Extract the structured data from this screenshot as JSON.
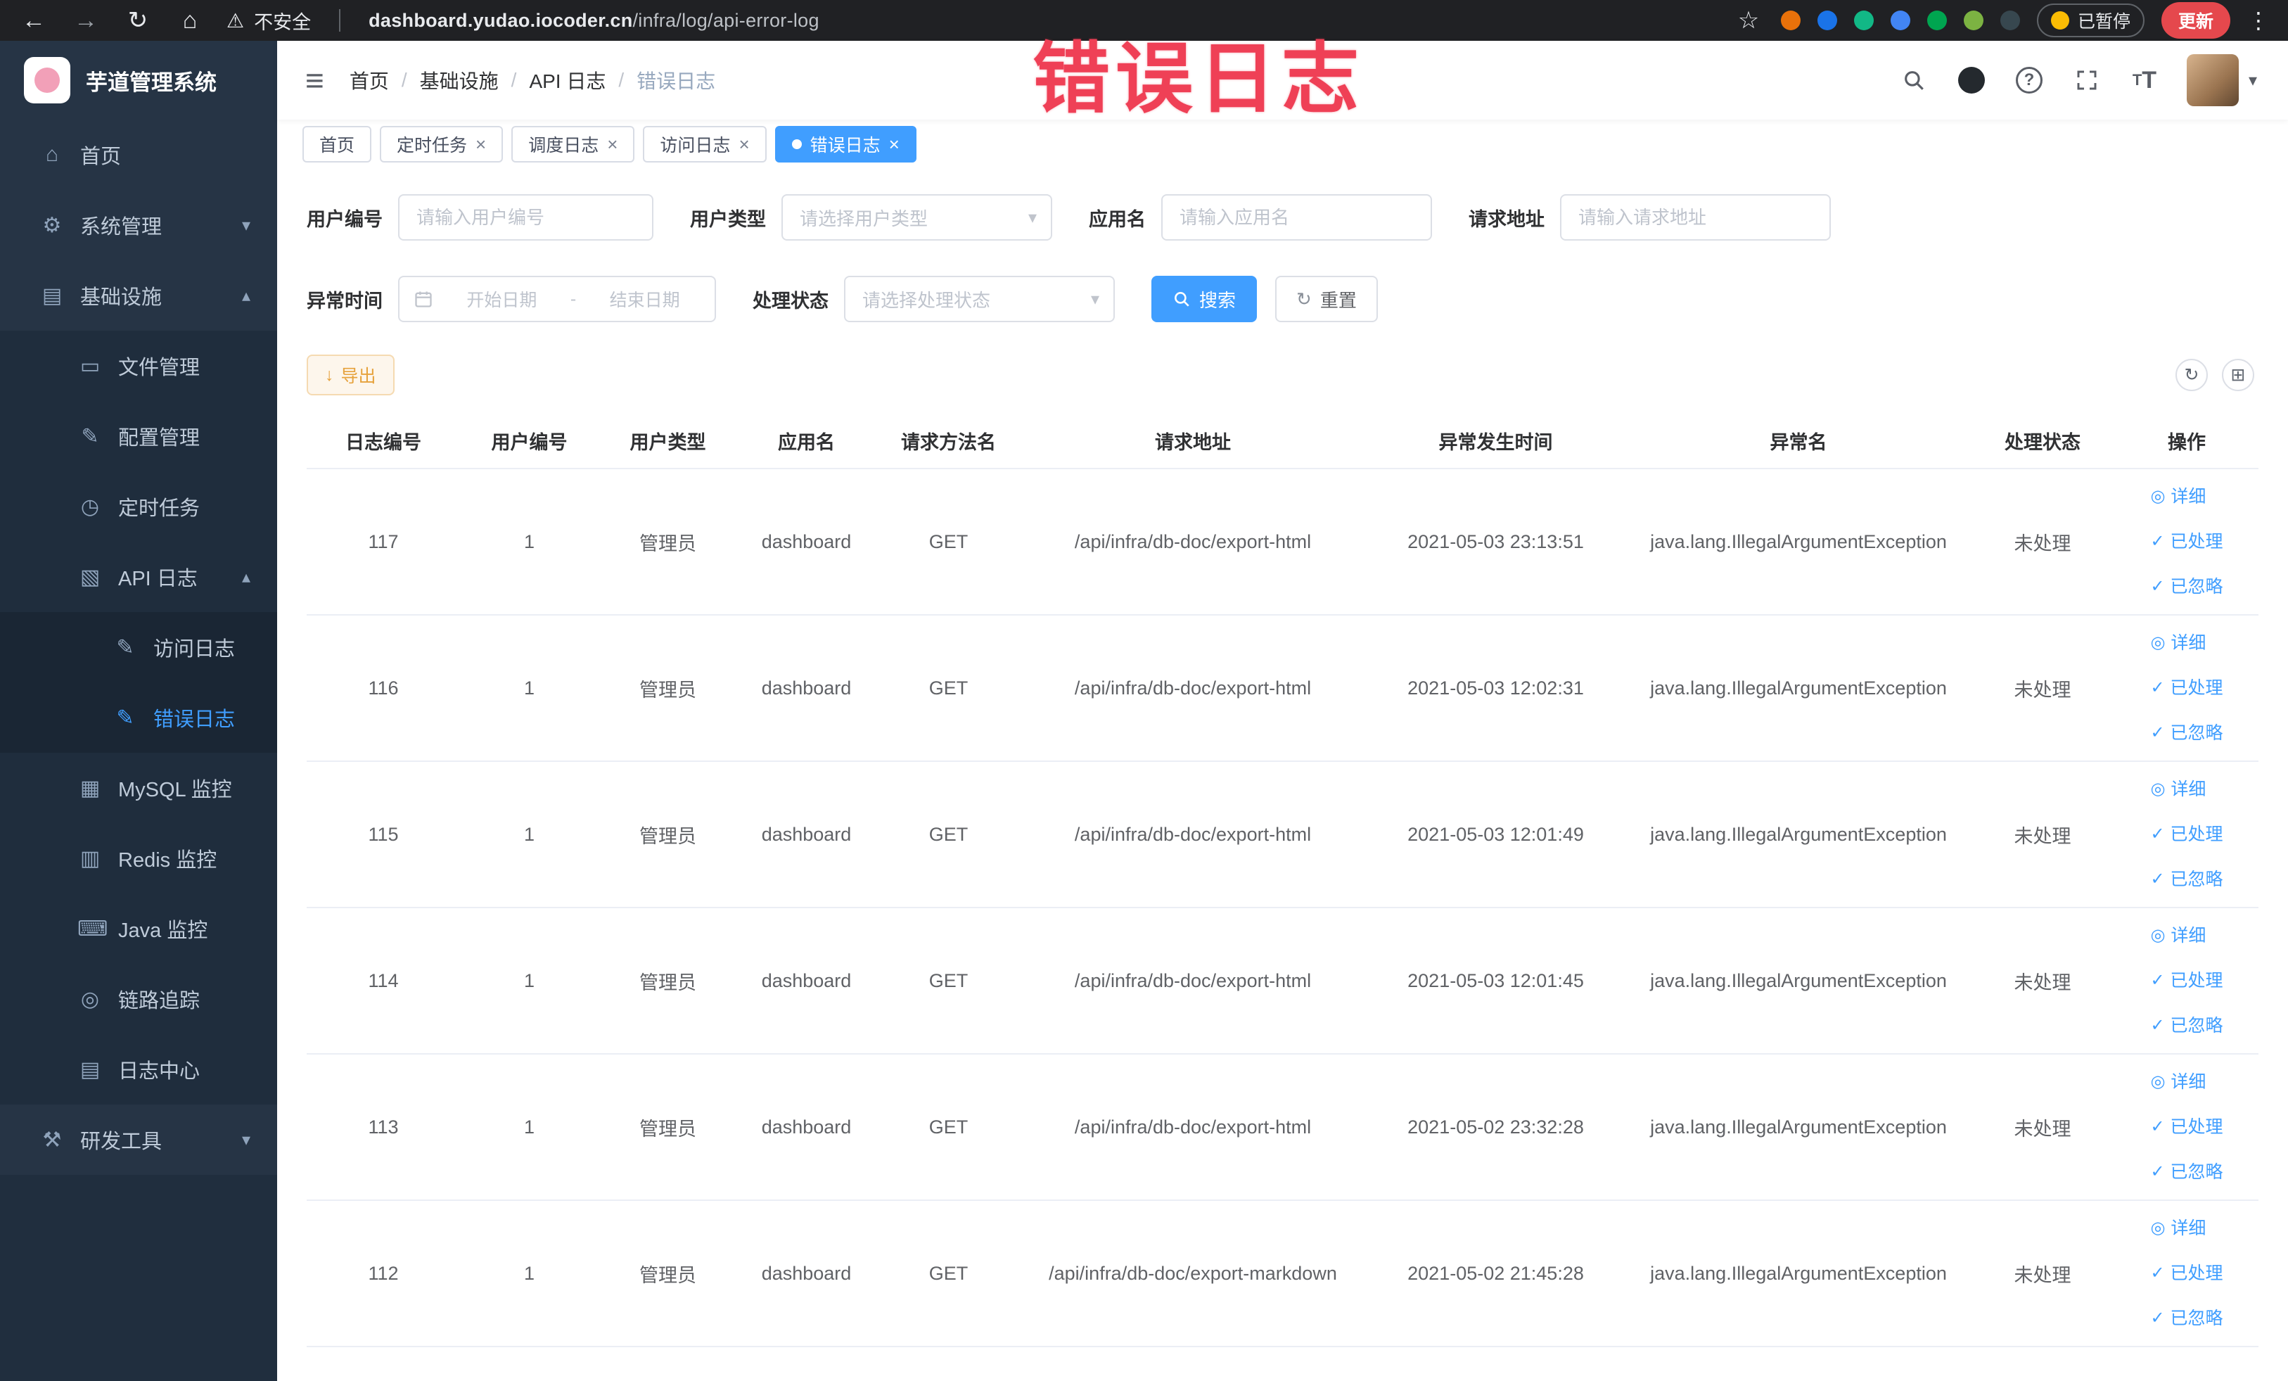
{
  "colors": {
    "accent": "#409eff",
    "warning": "#e6a23c",
    "watermark_red": "#ef4056",
    "sidebar_bg": "#263445",
    "submenu_bg": "#1f2d3d"
  },
  "icons": {
    "back": "←",
    "forward": "→",
    "refresh": "↻",
    "home_chrome": "⌂",
    "warning": "⚠",
    "star": "☆",
    "kebab": "⋮",
    "hamburger": "≡",
    "caret_down": "▾",
    "chevron_down": "▾",
    "chevron_up": "▴",
    "home": "⌂",
    "gear": "⚙",
    "infra": "▤",
    "file": "▭",
    "config": "✎",
    "timer": "◷",
    "api_log": "▧",
    "access_log": "✎",
    "error_log": "✎",
    "mysql": "▦",
    "redis": "▥",
    "java": "⌨",
    "trace": "◎",
    "log_center": "▤",
    "devtools": "⚒",
    "reset": "↻",
    "export": "↓",
    "refresh_mini": "↻",
    "columns_grid": "⊞",
    "eye": "◎",
    "check": "✓",
    "question": "?",
    "tsize_small": "T",
    "tsize_big": "T",
    "close": "×",
    "active_dot": "●",
    "breadcrumb_sep": "/",
    "url_sep": "|",
    "range_sep": "-"
  },
  "browser": {
    "security_warning": "不安全",
    "url_domain": "dashboard.yudao.iocoder.cn",
    "url_path": "/infra/log/api-error-log",
    "paused_badge": "已暂停",
    "update_button": "更新"
  },
  "watermark": "错误日志",
  "sidebar": {
    "logo_title": "芋道管理系统",
    "items": [
      {
        "label": "首页"
      },
      {
        "label": "系统管理"
      },
      {
        "label": "基础设施"
      },
      {
        "label": "文件管理"
      },
      {
        "label": "配置管理"
      },
      {
        "label": "定时任务"
      },
      {
        "label": "API 日志"
      },
      {
        "label": "访问日志"
      },
      {
        "label": "错误日志"
      },
      {
        "label": "MySQL 监控"
      },
      {
        "label": "Redis 监控"
      },
      {
        "label": "Java 监控"
      },
      {
        "label": "链路追踪"
      },
      {
        "label": "日志中心"
      },
      {
        "label": "研发工具"
      }
    ]
  },
  "breadcrumb": [
    "首页",
    "基础设施",
    "API 日志",
    "错误日志"
  ],
  "tabs": [
    {
      "label": "首页"
    },
    {
      "label": "定时任务"
    },
    {
      "label": "调度日志"
    },
    {
      "label": "访问日志"
    },
    {
      "label": "错误日志"
    }
  ],
  "filters": {
    "user_id": {
      "label": "用户编号",
      "placeholder": "请输入用户编号"
    },
    "user_type": {
      "label": "用户类型",
      "placeholder": "请选择用户类型"
    },
    "app_name": {
      "label": "应用名",
      "placeholder": "请输入应用名"
    },
    "request_url": {
      "label": "请求地址",
      "placeholder": "请输入请求地址"
    },
    "exception_time": {
      "label": "异常时间",
      "start_placeholder": "开始日期",
      "end_placeholder": "结束日期"
    },
    "process_status": {
      "label": "处理状态",
      "placeholder": "请选择处理状态"
    },
    "search_button": "搜索",
    "reset_button": "重置"
  },
  "toolbar": {
    "export_button": "导出"
  },
  "table": {
    "columns": [
      "日志编号",
      "用户编号",
      "用户类型",
      "应用名",
      "请求方法名",
      "请求地址",
      "异常发生时间",
      "异常名",
      "处理状态",
      "操作"
    ],
    "action_labels": {
      "detail": "详细",
      "processed": "已处理",
      "ignored": "已忽略"
    },
    "rows": [
      {
        "id": "117",
        "user_id": "1",
        "user_type": "管理员",
        "app": "dashboard",
        "method": "GET",
        "url": "/api/infra/db-doc/export-html",
        "time": "2021-05-03 23:13:51",
        "exception": "java.lang.IllegalArgumentException",
        "status": "未处理"
      },
      {
        "id": "116",
        "user_id": "1",
        "user_type": "管理员",
        "app": "dashboard",
        "method": "GET",
        "url": "/api/infra/db-doc/export-html",
        "time": "2021-05-03 12:02:31",
        "exception": "java.lang.IllegalArgumentException",
        "status": "未处理"
      },
      {
        "id": "115",
        "user_id": "1",
        "user_type": "管理员",
        "app": "dashboard",
        "method": "GET",
        "url": "/api/infra/db-doc/export-html",
        "time": "2021-05-03 12:01:49",
        "exception": "java.lang.IllegalArgumentException",
        "status": "未处理"
      },
      {
        "id": "114",
        "user_id": "1",
        "user_type": "管理员",
        "app": "dashboard",
        "method": "GET",
        "url": "/api/infra/db-doc/export-html",
        "time": "2021-05-03 12:01:45",
        "exception": "java.lang.IllegalArgumentException",
        "status": "未处理"
      },
      {
        "id": "113",
        "user_id": "1",
        "user_type": "管理员",
        "app": "dashboard",
        "method": "GET",
        "url": "/api/infra/db-doc/export-html",
        "time": "2021-05-02 23:32:28",
        "exception": "java.lang.IllegalArgumentException",
        "status": "未处理"
      },
      {
        "id": "112",
        "user_id": "1",
        "user_type": "管理员",
        "app": "dashboard",
        "method": "GET",
        "url": "/api/infra/db-doc/export-markdown",
        "time": "2021-05-02 21:45:28",
        "exception": "java.lang.IllegalArgumentException",
        "status": "未处理"
      }
    ]
  }
}
